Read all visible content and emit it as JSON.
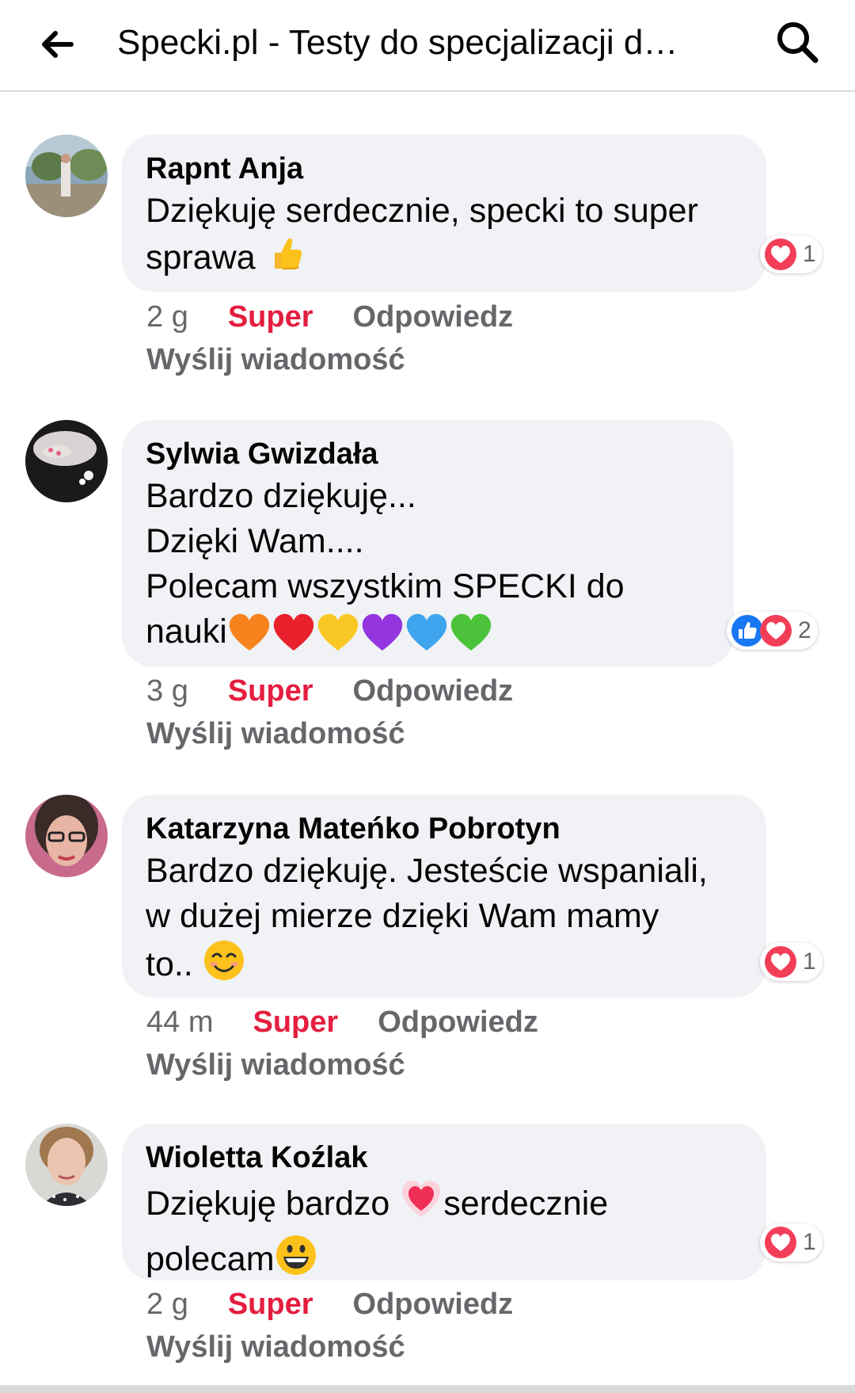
{
  "header": {
    "title": "Specki.pl - Testy do specjalizacji d…",
    "back_icon": "arrow-left-icon",
    "search_icon": "search-icon"
  },
  "colors": {
    "bubble_bg": "#f0f2f5",
    "super_red": "#e41e3f",
    "meta_gray": "#65676b",
    "like_blue": "#1877f2",
    "love_red": "#f33e58"
  },
  "comments": [
    {
      "author": "Rapnt Anja",
      "lines": [
        "Dziękuję serdecznie, specki to super",
        "sprawa"
      ],
      "emoji": [
        "thumbs-up-emoji"
      ],
      "reactions": [
        "love"
      ],
      "reaction_count": "1",
      "time": "2 g",
      "super": "Super",
      "reply": "Odpowiedz",
      "send": "Wyślij wiadomość"
    },
    {
      "author": "Sylwia Gwizdała",
      "lines": [
        "Bardzo dziękuję...",
        "Dzięki Wam....",
        "Polecam wszystkim SPECKI do",
        "nauki"
      ],
      "emoji": [
        "orange-heart-emoji",
        "red-heart-emoji",
        "yellow-heart-emoji",
        "purple-heart-emoji",
        "blue-heart-emoji",
        "green-heart-emoji"
      ],
      "reactions": [
        "like",
        "love"
      ],
      "reaction_count": "2",
      "time": "3 g",
      "super": "Super",
      "reply": "Odpowiedz",
      "send": "Wyślij wiadomość"
    },
    {
      "author": "Katarzyna Mateńko Pobrotyn",
      "lines": [
        "Bardzo dziękuję. Jesteście wspaniali,",
        "w dużej mierze dzięki Wam mamy",
        "to.."
      ],
      "emoji": [
        "smiling-face-emoji"
      ],
      "reactions": [
        "love"
      ],
      "reaction_count": "1",
      "time": "44 m",
      "super": "Super",
      "reply": "Odpowiedz",
      "send": "Wyślij wiadomość"
    },
    {
      "author": "Wioletta Koźlak",
      "lines": [
        "Dziękuję bardzo",
        "serdecznie",
        "polecam"
      ],
      "emoji": [
        "heart-pulse-emoji",
        "grinning-face-emoji"
      ],
      "reactions": [
        "love"
      ],
      "reaction_count": "1",
      "time": "2 g",
      "super": "Super",
      "reply": "Odpowiedz",
      "send": "Wyślij wiadomość"
    }
  ]
}
